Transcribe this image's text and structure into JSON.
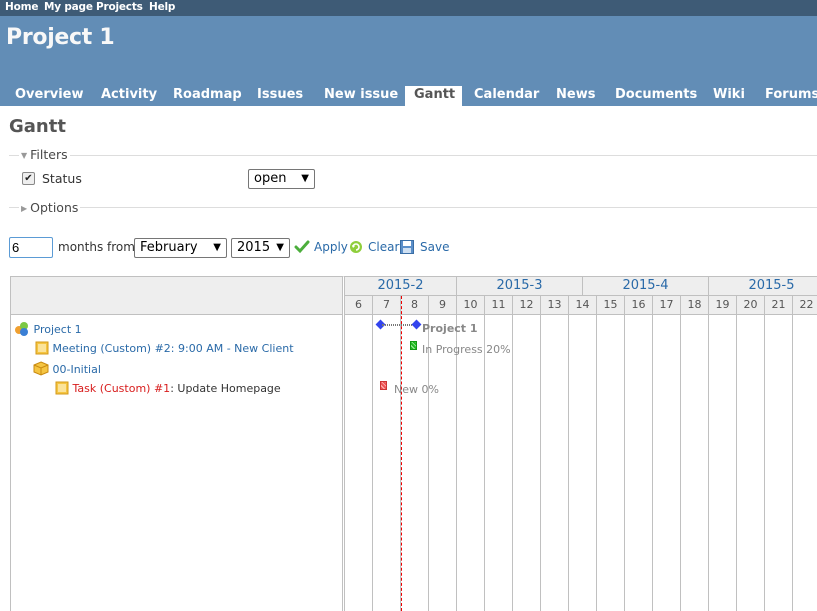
{
  "top_menu": [
    "Home",
    "My page",
    "Projects",
    "Help"
  ],
  "header": {
    "project_title": "Project 1"
  },
  "main_menu": {
    "tabs": [
      "Overview",
      "Activity",
      "Roadmap",
      "Issues",
      "New issue",
      "Gantt",
      "Calendar",
      "News",
      "Documents",
      "Wiki",
      "Forums"
    ],
    "selected": "Gantt"
  },
  "page_title": "Gantt",
  "filters": {
    "legend": "Filters",
    "status_label": "Status",
    "status_checked": true,
    "status_operator": "open"
  },
  "options": {
    "legend": "Options"
  },
  "controls": {
    "months_value": "6",
    "months_from_label": "months from",
    "month_select": "February",
    "year_select": "2015",
    "apply_label": "Apply",
    "clear_label": "Clear",
    "save_label": "Save"
  },
  "gantt": {
    "months": [
      "2015-2",
      "2015-3",
      "2015-4",
      "2015-5"
    ],
    "weeks": [
      "6",
      "7",
      "8",
      "9",
      "10",
      "11",
      "12",
      "13",
      "14",
      "15",
      "16",
      "17",
      "18",
      "19",
      "20",
      "21",
      "22"
    ],
    "subjects": [
      {
        "type": "project",
        "label": "Project 1"
      },
      {
        "type": "issue",
        "tracker": "Meeting (Custom) #2",
        "subject": ": 9:00 AM - New Client"
      },
      {
        "type": "version",
        "label": "00-Initial"
      },
      {
        "type": "issue",
        "tracker": "Task (Custom) #1",
        "subject": ": Update Homepage"
      }
    ],
    "bars": {
      "project_label": "Project 1",
      "meeting_label": "In Progress 20%",
      "task_label": "New 0%"
    },
    "colors": {
      "project_diamond": "#3344ee",
      "in_progress_bar": "#22bb22",
      "new_bar": "#ee5555",
      "today_line": "#ee0000"
    }
  }
}
